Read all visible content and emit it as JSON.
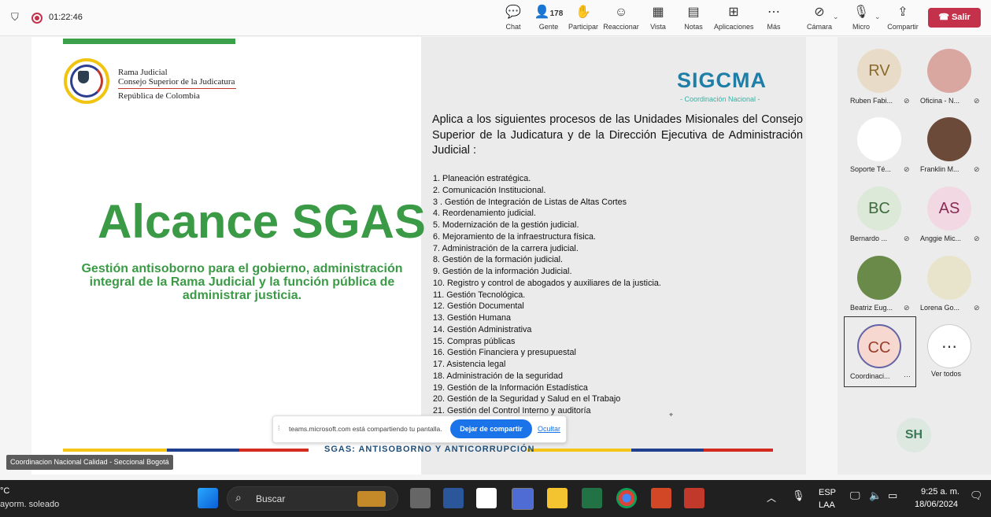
{
  "topbar": {
    "timer": "01:22:46",
    "people_count": "178",
    "items": [
      {
        "label": "Chat",
        "icon": "chat-icon"
      },
      {
        "label": "Gente",
        "icon": "people-icon"
      },
      {
        "label": "Participar",
        "icon": "raise-hand-icon"
      },
      {
        "label": "Reaccionar",
        "icon": "react-icon"
      },
      {
        "label": "Vista",
        "icon": "view-icon"
      },
      {
        "label": "Notas",
        "icon": "notes-icon"
      },
      {
        "label": "Aplicaciones",
        "icon": "apps-icon"
      },
      {
        "label": "Más",
        "icon": "more-icon"
      },
      {
        "label": "Cámara",
        "icon": "camera-off-icon"
      },
      {
        "label": "Micro",
        "icon": "mic-off-icon"
      },
      {
        "label": "Compartir",
        "icon": "share-icon"
      }
    ],
    "leave_label": "Salir"
  },
  "slide": {
    "org_lines": [
      "Rama Judicial",
      "Consejo Superior de la Judicatura",
      "República de Colombia"
    ],
    "title": "Alcance SGAS",
    "subtitle": "Gestión antisoborno para el gobierno, administración integral de la Rama Judicial  y la función pública de administrar justicia.",
    "brand": "SIGCMA",
    "brand_sub": "- Coordinación Nacional -",
    "intro": "Aplica a los siguientes procesos de las Unidades Misionales del Consejo Superior de la Judicatura y de la Dirección Ejecutiva de Administración Judicial :",
    "processes": [
      "1. Planeación estratégica.",
      "2.  Comunicación Institucional.",
      "3 . Gestión de Integración de Listas de Altas Cortes",
      "4. Reordenamiento judicial.",
      "5. Modernización de la gestión judicial.",
      "6. Mejoramiento de la infraestructura física.",
      "7. Administración de la carrera judicial.",
      "8. Gestión de la formación judicial.",
      "9. Gestión de la información Judicial.",
      "10.  Registro y control de abogados y auxiliares de la justicia.",
      "11. Gestión Tecnológica.",
      "12. Gestión Documental",
      "13.  Gestión Humana",
      "14.  Gestión Administrativa",
      "15.  Compras públicas",
      "16.  Gestión Financiera y presupuestal",
      "17.  Asistencia legal",
      "18.  Administración de la seguridad",
      "19. Gestión de la Información Estadística",
      "20. Gestión de la Seguridad y Salud en el Trabajo",
      "21. Gestión del Control Interno y auditoría"
    ],
    "footer": "SGAS: ANTISOBORNO Y ANTICORRUPCIÓN"
  },
  "share_notice": {
    "text": "teams.microsoft.com está compartiendo tu pantalla.",
    "stop_label": "Dejar de compartir",
    "hide_label": "Ocultar"
  },
  "presenter_label": "Coordinacion Nacional Calidad - Seccional Bogotá",
  "participants": [
    {
      "initials": "RV",
      "name": "Ruben Fabi...",
      "color": "#e8dcc8",
      "text_color": "#8a6a2a"
    },
    {
      "initials": "",
      "name": "Oficina - N...",
      "color": "#d9a6a0",
      "text_color": "#000"
    },
    {
      "initials": "",
      "name": "Soporte Té...",
      "color": "#ffffff",
      "text_color": "#000"
    },
    {
      "initials": "",
      "name": "Franklin M...",
      "color": "#6b4a3a",
      "text_color": "#000"
    },
    {
      "initials": "BC",
      "name": "Bernardo ...",
      "color": "#dce8d8",
      "text_color": "#3d6b3a"
    },
    {
      "initials": "AS",
      "name": "Anggie Mic...",
      "color": "#f2d8e2",
      "text_color": "#8a2a55"
    },
    {
      "initials": "",
      "name": "Beatriz Eug...",
      "color": "#6a8a4a",
      "text_color": "#000"
    },
    {
      "initials": "",
      "name": "Lorena Go...",
      "color": "#e8e4cc",
      "text_color": "#000"
    },
    {
      "initials": "CC",
      "name": "Coordinaci...",
      "color": "#f6d8d0",
      "text_color": "#9a3a2a"
    },
    {
      "initials": "⋯",
      "name": "Ver todos",
      "color": "#ffffff",
      "text_color": "#333"
    }
  ],
  "self_view_initials": "SH",
  "taskbar": {
    "weather_temp": "°C",
    "weather_desc": "ayorm. soleado",
    "search_placeholder": "Buscar",
    "lang": "ESP",
    "lang_sub": "LAA",
    "time": "9:25 a. m.",
    "date": "18/06/2024"
  }
}
